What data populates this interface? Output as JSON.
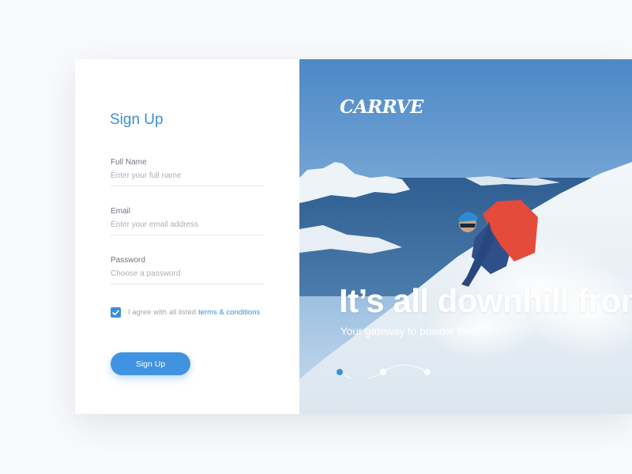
{
  "form": {
    "title": "Sign Up",
    "fields": [
      {
        "label": "Full Name",
        "placeholder": "Enter your full name",
        "value": ""
      },
      {
        "label": "Email",
        "placeholder": "Enter your email address",
        "value": ""
      },
      {
        "label": "Password",
        "placeholder": "Choose a password",
        "value": ""
      }
    ],
    "agree": {
      "text": "I agree with all listed",
      "link": "terms & conditions",
      "checked": true
    },
    "submit_label": "Sign Up"
  },
  "hero": {
    "logo": "CARRVE",
    "headline": "It’s all downhill from here",
    "subline": "Your gateway to powder time",
    "slides": {
      "count": 3,
      "active": 1
    }
  },
  "colors": {
    "accent": "#3a8fd6",
    "button": "#3f93e0",
    "page_bg": "#f9fafc"
  },
  "icons": {
    "checkbox": "checkmark-icon"
  }
}
